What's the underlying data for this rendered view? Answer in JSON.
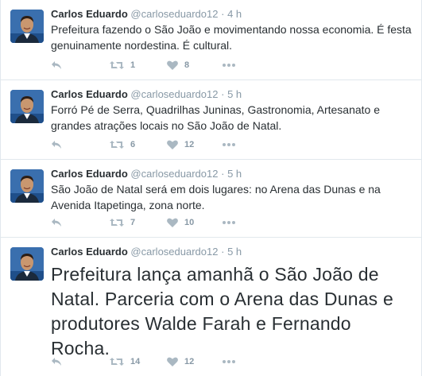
{
  "author": {
    "fullname": "Carlos Eduardo",
    "username": "@carloseduardo12"
  },
  "separator": "·",
  "tweets": [
    {
      "time": "4 h",
      "text": "Prefeitura fazendo o São João e movimentando nossa economia. É festa genuinamente nordestina. É cultural.",
      "retweets": "1",
      "likes": "8"
    },
    {
      "time": "5 h",
      "text": "Forró Pé de Serra, Quadrilhas Juninas, Gastronomia, Artesanato e grandes atrações locais no São João de Natal.",
      "retweets": "6",
      "likes": "12"
    },
    {
      "time": "5 h",
      "text": "São João de Natal será em dois lugares: no Arena das Dunas e na Avenida Itapetinga, zona norte.",
      "retweets": "7",
      "likes": "10"
    },
    {
      "time": "5 h",
      "text": "Prefeitura lança amanhã o São João de Natal. Parceria com o Arena das Dunas e produtores Walde Farah e Fernando Rocha.",
      "retweets": "14",
      "likes": "12"
    }
  ],
  "icons": {
    "reply": "reply-icon",
    "retweet": "retweet-icon",
    "like": "heart-icon",
    "more": "more-dots-icon"
  },
  "colors": {
    "text": "#292f33",
    "muted": "#8899a6",
    "divider": "#e1e8ed",
    "icon": "#aab8c2"
  }
}
